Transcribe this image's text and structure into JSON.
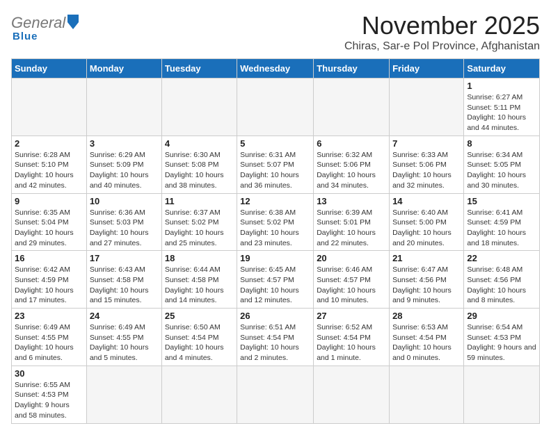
{
  "header": {
    "logo_general": "General",
    "logo_blue": "Blue",
    "title": "November 2025",
    "subtitle": "Chiras, Sar-e Pol Province, Afghanistan"
  },
  "weekdays": [
    "Sunday",
    "Monday",
    "Tuesday",
    "Wednesday",
    "Thursday",
    "Friday",
    "Saturday"
  ],
  "days": {
    "d1": {
      "num": "1",
      "sunrise": "6:27 AM",
      "sunset": "5:11 PM",
      "daylight": "10 hours and 44 minutes."
    },
    "d2": {
      "num": "2",
      "sunrise": "6:28 AM",
      "sunset": "5:10 PM",
      "daylight": "10 hours and 42 minutes."
    },
    "d3": {
      "num": "3",
      "sunrise": "6:29 AM",
      "sunset": "5:09 PM",
      "daylight": "10 hours and 40 minutes."
    },
    "d4": {
      "num": "4",
      "sunrise": "6:30 AM",
      "sunset": "5:08 PM",
      "daylight": "10 hours and 38 minutes."
    },
    "d5": {
      "num": "5",
      "sunrise": "6:31 AM",
      "sunset": "5:07 PM",
      "daylight": "10 hours and 36 minutes."
    },
    "d6": {
      "num": "6",
      "sunrise": "6:32 AM",
      "sunset": "5:06 PM",
      "daylight": "10 hours and 34 minutes."
    },
    "d7": {
      "num": "7",
      "sunrise": "6:33 AM",
      "sunset": "5:06 PM",
      "daylight": "10 hours and 32 minutes."
    },
    "d8": {
      "num": "8",
      "sunrise": "6:34 AM",
      "sunset": "5:05 PM",
      "daylight": "10 hours and 30 minutes."
    },
    "d9": {
      "num": "9",
      "sunrise": "6:35 AM",
      "sunset": "5:04 PM",
      "daylight": "10 hours and 29 minutes."
    },
    "d10": {
      "num": "10",
      "sunrise": "6:36 AM",
      "sunset": "5:03 PM",
      "daylight": "10 hours and 27 minutes."
    },
    "d11": {
      "num": "11",
      "sunrise": "6:37 AM",
      "sunset": "5:02 PM",
      "daylight": "10 hours and 25 minutes."
    },
    "d12": {
      "num": "12",
      "sunrise": "6:38 AM",
      "sunset": "5:02 PM",
      "daylight": "10 hours and 23 minutes."
    },
    "d13": {
      "num": "13",
      "sunrise": "6:39 AM",
      "sunset": "5:01 PM",
      "daylight": "10 hours and 22 minutes."
    },
    "d14": {
      "num": "14",
      "sunrise": "6:40 AM",
      "sunset": "5:00 PM",
      "daylight": "10 hours and 20 minutes."
    },
    "d15": {
      "num": "15",
      "sunrise": "6:41 AM",
      "sunset": "4:59 PM",
      "daylight": "10 hours and 18 minutes."
    },
    "d16": {
      "num": "16",
      "sunrise": "6:42 AM",
      "sunset": "4:59 PM",
      "daylight": "10 hours and 17 minutes."
    },
    "d17": {
      "num": "17",
      "sunrise": "6:43 AM",
      "sunset": "4:58 PM",
      "daylight": "10 hours and 15 minutes."
    },
    "d18": {
      "num": "18",
      "sunrise": "6:44 AM",
      "sunset": "4:58 PM",
      "daylight": "10 hours and 14 minutes."
    },
    "d19": {
      "num": "19",
      "sunrise": "6:45 AM",
      "sunset": "4:57 PM",
      "daylight": "10 hours and 12 minutes."
    },
    "d20": {
      "num": "20",
      "sunrise": "6:46 AM",
      "sunset": "4:57 PM",
      "daylight": "10 hours and 10 minutes."
    },
    "d21": {
      "num": "21",
      "sunrise": "6:47 AM",
      "sunset": "4:56 PM",
      "daylight": "10 hours and 9 minutes."
    },
    "d22": {
      "num": "22",
      "sunrise": "6:48 AM",
      "sunset": "4:56 PM",
      "daylight": "10 hours and 8 minutes."
    },
    "d23": {
      "num": "23",
      "sunrise": "6:49 AM",
      "sunset": "4:55 PM",
      "daylight": "10 hours and 6 minutes."
    },
    "d24": {
      "num": "24",
      "sunrise": "6:49 AM",
      "sunset": "4:55 PM",
      "daylight": "10 hours and 5 minutes."
    },
    "d25": {
      "num": "25",
      "sunrise": "6:50 AM",
      "sunset": "4:54 PM",
      "daylight": "10 hours and 4 minutes."
    },
    "d26": {
      "num": "26",
      "sunrise": "6:51 AM",
      "sunset": "4:54 PM",
      "daylight": "10 hours and 2 minutes."
    },
    "d27": {
      "num": "27",
      "sunrise": "6:52 AM",
      "sunset": "4:54 PM",
      "daylight": "10 hours and 1 minute."
    },
    "d28": {
      "num": "28",
      "sunrise": "6:53 AM",
      "sunset": "4:54 PM",
      "daylight": "10 hours and 0 minutes."
    },
    "d29": {
      "num": "29",
      "sunrise": "6:54 AM",
      "sunset": "4:53 PM",
      "daylight": "9 hours and 59 minutes."
    },
    "d30": {
      "num": "30",
      "sunrise": "6:55 AM",
      "sunset": "4:53 PM",
      "daylight": "9 hours and 58 minutes."
    }
  },
  "labels": {
    "sunrise": "Sunrise:",
    "sunset": "Sunset:",
    "daylight": "Daylight:"
  }
}
